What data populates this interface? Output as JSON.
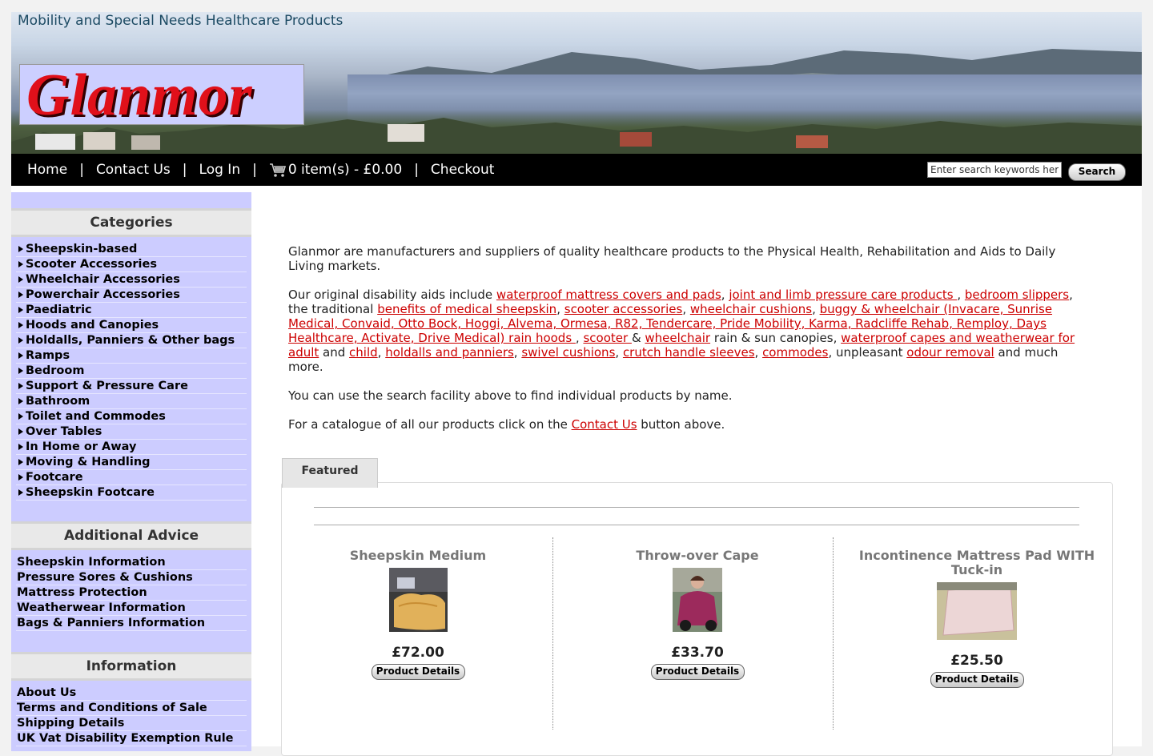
{
  "header": {
    "tagline": "Mobility and Special Needs Healthcare Products",
    "logo": "Glanmor"
  },
  "nav": {
    "home": "Home",
    "contact": "Contact Us",
    "login": "Log In",
    "cart": "0 item(s) - £0.00",
    "checkout": "Checkout",
    "separator": "|",
    "search_placeholder": "Enter search keywords here",
    "search_button": "Search"
  },
  "sidebar": {
    "categories_title": "Categories",
    "categories": [
      "Sheepskin-based",
      "Scooter Accessories",
      "Wheelchair Accessories",
      "Powerchair Accessories",
      "Paediatric",
      "Hoods and Canopies",
      "Holdalls, Panniers & Other bags",
      "Ramps",
      "Bedroom",
      "Support & Pressure Care",
      "Bathroom",
      "Toilet and Commodes",
      "Over Tables",
      "In Home or Away",
      "Moving & Handling",
      "Footcare",
      "Sheepskin Footcare"
    ],
    "advice_title": "Additional Advice",
    "advice": [
      "Sheepskin Information",
      "Pressure Sores & Cushions",
      "Mattress Protection",
      "Weatherwear Information",
      "Bags & Panniers Information"
    ],
    "info_title": "Information",
    "info": [
      "About Us",
      "Terms and Conditions of Sale",
      "Shipping Details",
      "UK Vat Disability Exemption Rule"
    ]
  },
  "content": {
    "intro": "Glanmor are manufacturers and suppliers of quality healthcare products to the Physical Health, Rehabilitation and Aids to Daily Living markets.",
    "p2_start": "Our original disability aids include ",
    "links": {
      "mattress": "waterproof mattress covers and pads",
      "joint": "joint and limb pressure care products ",
      "slippers": "bedroom slippers",
      "sheepskin": "benefits of medical sheepskin",
      "scooter_acc": "scooter accessories",
      "cushions": "wheelchair cushions",
      "buggy": "buggy & wheelchair (Invacare, Sunrise Medical, Convaid, Otto Bock, Hoggi, Alvema, Ormesa, R82, Tendercare, Pride Mobility, Karma, Radcliffe Rehab, Remploy, Days Healthcare, Activate, Drive Medical) rain hoods ",
      "scooter": "scooter ",
      "wheelchair": "wheelchair",
      "capes": "waterproof capes and weatherwear for adult",
      "child": "child",
      "holdalls": "holdalls and panniers",
      "swivel": "swivel cushions",
      "crutch": "crutch handle sleeves",
      "commodes": "commodes",
      "odour": "odour removal"
    },
    "t_comma": ", ",
    "t_the_traditional": ", the traditional ",
    "t_comma_space": ", ",
    "t_amp": " & ",
    "t_rain": " rain & sun canopies, ",
    "t_and": " and ",
    "t_unpleasant": ", unpleasant ",
    "t_end": " and much more.",
    "search_text": "You can use the search facility above to find individual products by name.",
    "catalogue_start": "For a catalogue of all our products click on the ",
    "catalogue_link": "Contact Us",
    "catalogue_end": " button above."
  },
  "featured": {
    "tab": "Featured",
    "products": [
      {
        "name": "Sheepskin Medium",
        "price": "£72.00",
        "button": "Product Details"
      },
      {
        "name": "Throw-over Cape",
        "price": "£33.70",
        "button": "Product Details"
      },
      {
        "name": "Incontinence Mattress Pad WITH Tuck-in",
        "price": "£25.50",
        "button": "Product Details"
      }
    ]
  }
}
